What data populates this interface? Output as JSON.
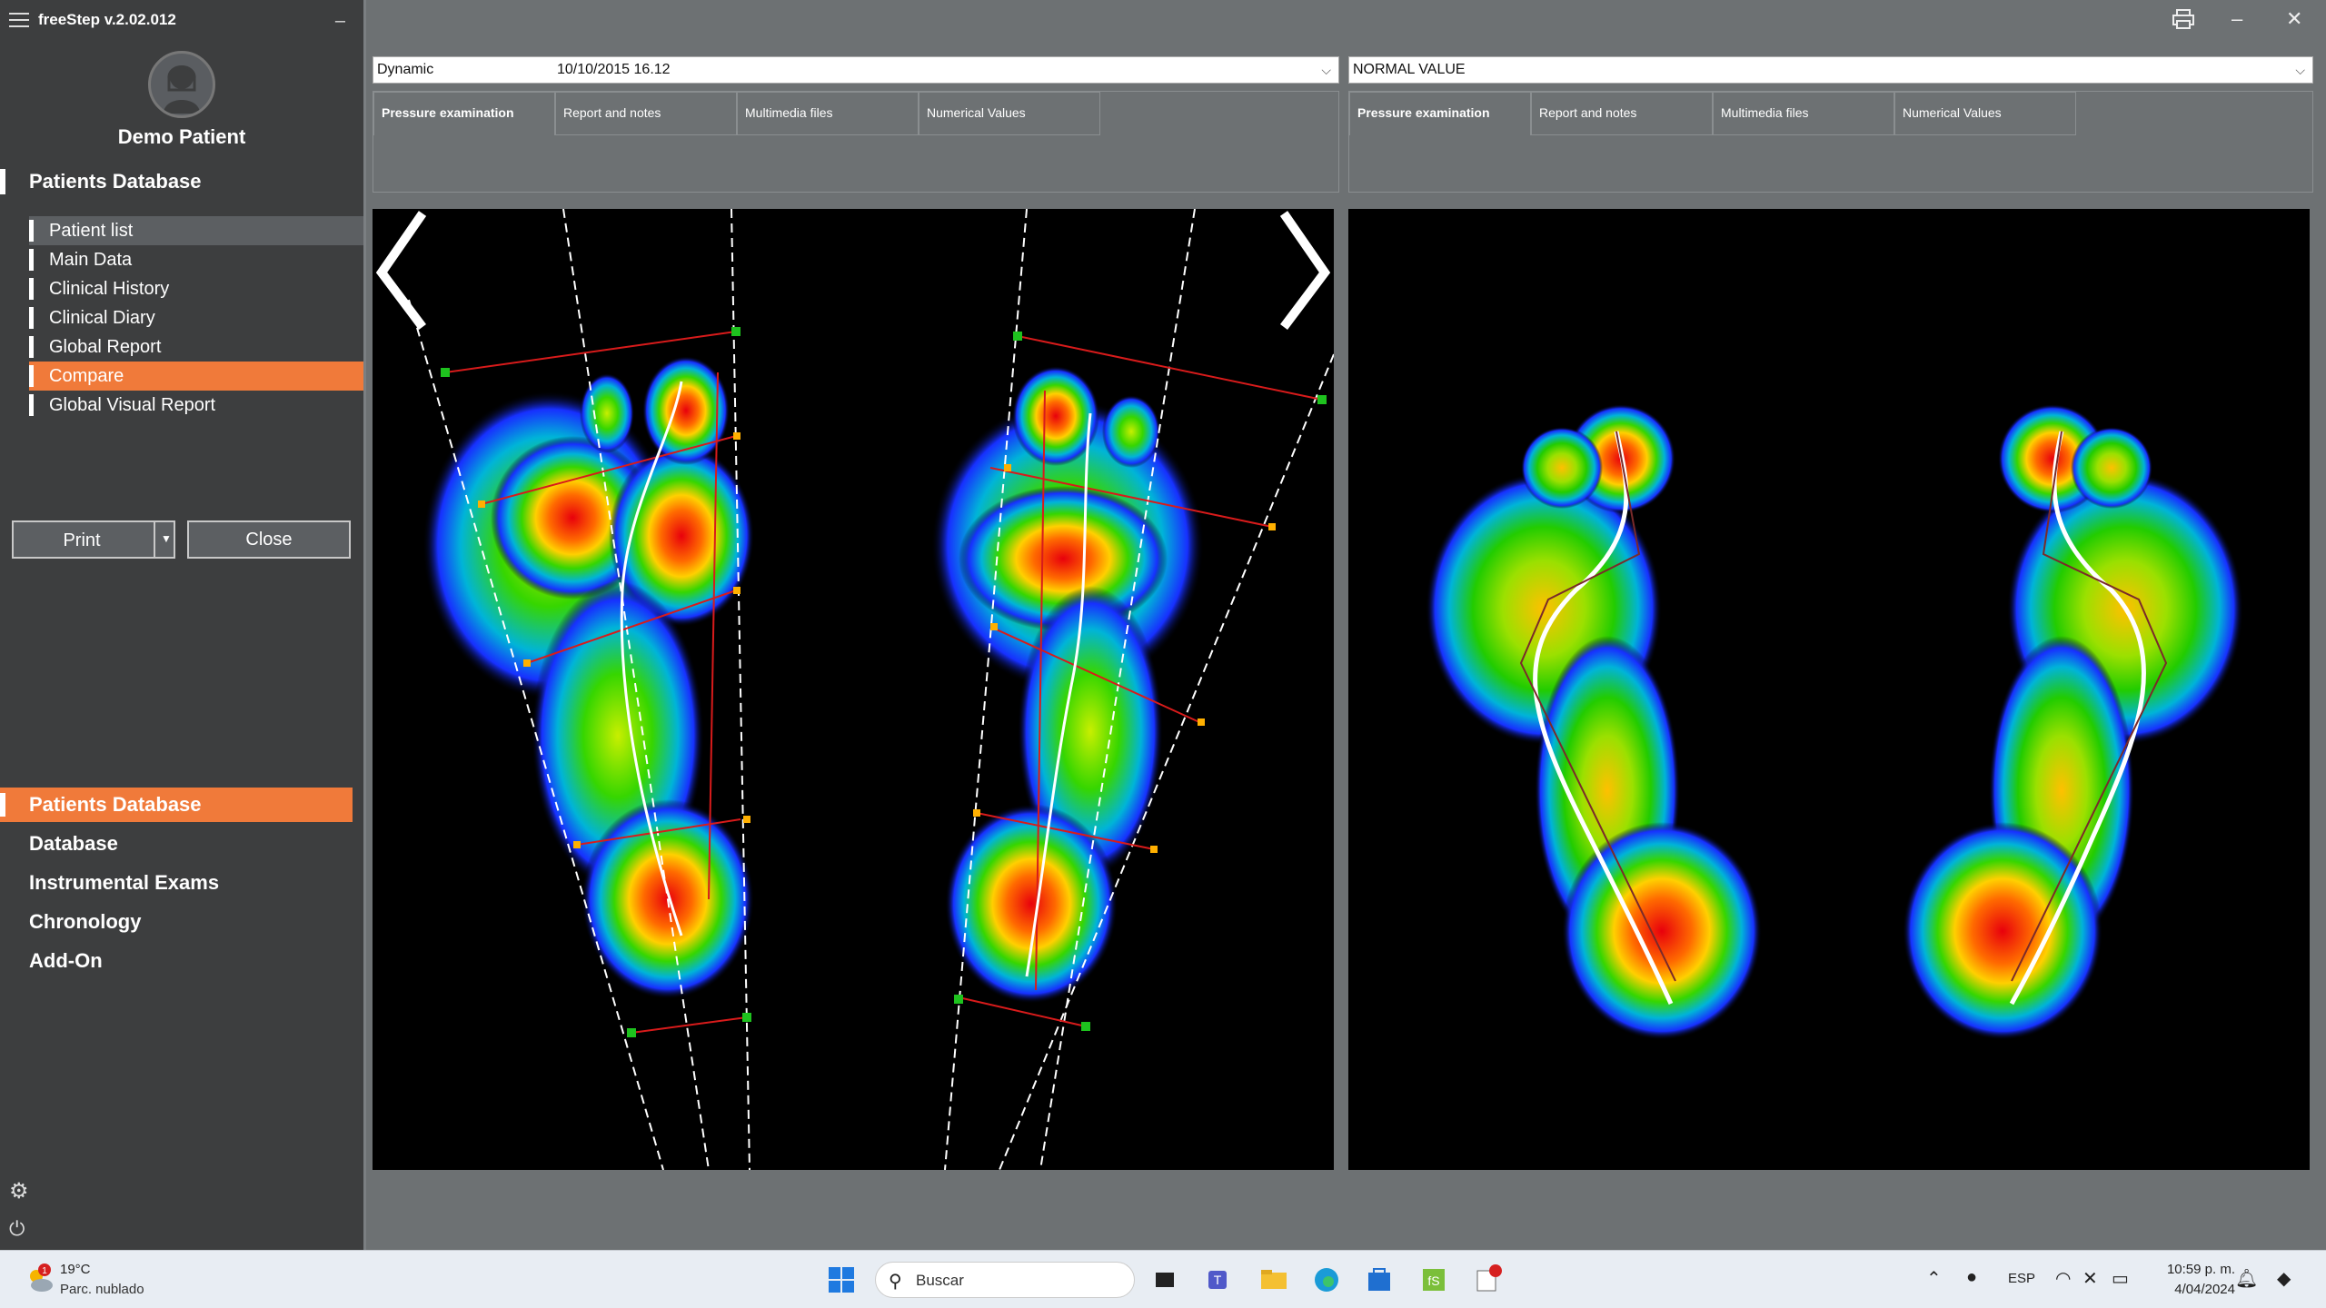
{
  "app": {
    "title": "freeStep v.2.02.012"
  },
  "patient": {
    "name": "Demo Patient"
  },
  "sidebar": {
    "section_title": "Patients Database",
    "sub_items": [
      {
        "label": "Patient list",
        "state": "hover"
      },
      {
        "label": "Main Data",
        "state": ""
      },
      {
        "label": "Clinical History",
        "state": ""
      },
      {
        "label": "Clinical Diary",
        "state": ""
      },
      {
        "label": "Global Report",
        "state": ""
      },
      {
        "label": "Compare",
        "state": "active"
      },
      {
        "label": "Global Visual Report",
        "state": ""
      }
    ],
    "print_label": "Print",
    "close_label": "Close",
    "main_nav": [
      {
        "label": "Patients Database",
        "active": true
      },
      {
        "label": "Database",
        "active": false
      },
      {
        "label": "Instrumental Exams",
        "active": false
      },
      {
        "label": "Chronology",
        "active": false
      },
      {
        "label": "Add-On",
        "active": false
      }
    ]
  },
  "left_panel": {
    "exam_type": "Dynamic",
    "exam_date": "10/10/2015 16.12",
    "tabs": [
      "Pressure examination",
      "Report and notes",
      "Multimedia files",
      "Numerical Values"
    ],
    "active_tab": 0
  },
  "right_panel": {
    "reference": "NORMAL VALUE",
    "tabs": [
      "Pressure examination",
      "Report and notes",
      "Multimedia files",
      "Numerical Values"
    ],
    "active_tab": 0
  },
  "taskbar": {
    "weather_temp": "19°C",
    "weather_desc": "Parc. nublado",
    "weather_badge": "1",
    "search_placeholder": "Buscar",
    "language": "ESP",
    "time": "10:59 p. m.",
    "date": "4/04/2024"
  },
  "colors": {
    "accent": "#f07a3a",
    "sidebar_bg": "#3d3e3f",
    "content_bg": "#6d7173"
  }
}
